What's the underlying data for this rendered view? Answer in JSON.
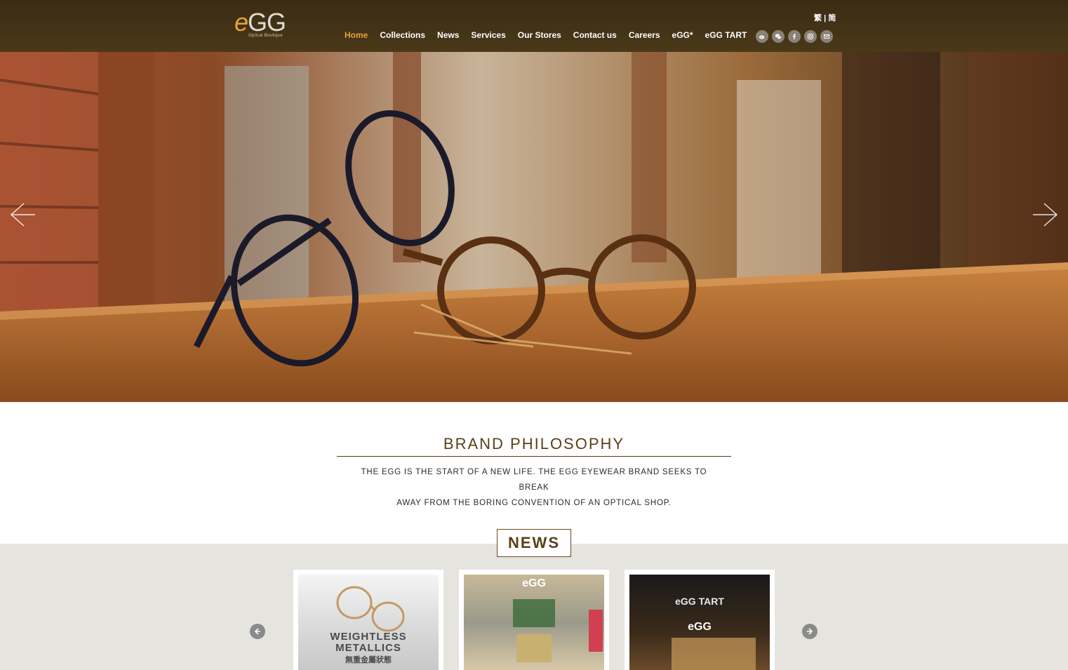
{
  "header": {
    "logo_text": "GG",
    "logo_e": "e",
    "logo_sub": "Optical Boutique",
    "nav": [
      "Home",
      "Collections",
      "News",
      "Services",
      "Our Stores",
      "Contact us",
      "Careers",
      "eGG*",
      "eGG TART"
    ],
    "active_nav": "Home",
    "lang_trad": "繁",
    "lang_sep": "|",
    "lang_simp": "简",
    "social_icons": [
      "weibo-icon",
      "wechat-icon",
      "facebook-icon",
      "instagram-icon",
      "email-icon"
    ]
  },
  "brand": {
    "title": "BRAND PHILOSOPHY",
    "line1": "THE EGG IS THE START OF A NEW LIFE. THE EGG EYEWEAR BRAND SEEKS TO BREAK",
    "line2": "AWAY FROM THE BORING CONVENTION OF AN OPTICAL SHOP."
  },
  "news": {
    "title": "NEWS",
    "cards": [
      {
        "label1": "WEIGHTLESS",
        "label2": "METALLICS",
        "label3": "無重金屬狀態"
      },
      {
        "label1": "eGG"
      },
      {
        "label1": "eGG TART",
        "label2": "eGG"
      }
    ]
  },
  "colors": {
    "accent": "#e8a23a",
    "brand_brown": "#5a4018",
    "header_bg": "#3a2c14"
  }
}
